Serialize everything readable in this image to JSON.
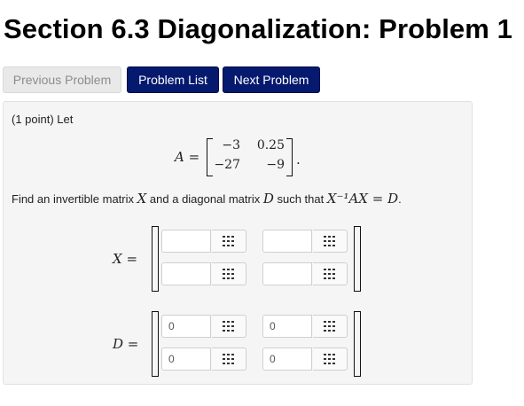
{
  "page": {
    "title": "Section 6.3 Diagonalization: Problem 1"
  },
  "nav": {
    "previous_label": "Previous Problem",
    "list_label": "Problem List",
    "next_label": "Next Problem"
  },
  "problem": {
    "intro": "(1 point) Let",
    "matrix_a_label": "A =",
    "matrix_a": [
      [
        "−3",
        "0.25"
      ],
      [
        "−27",
        "−9"
      ]
    ],
    "matrix_a_period": ".",
    "find_text_1": "Find an invertible matrix ",
    "find_var_x": "X",
    "find_text_2": " and a diagonal matrix ",
    "find_var_d": "D",
    "find_text_3": " such that ",
    "find_equation": "X⁻¹AX = D",
    "find_text_4": "."
  },
  "answer_x": {
    "label": "X =",
    "cells": [
      {
        "value": "",
        "placeholder": ""
      },
      {
        "value": "",
        "placeholder": ""
      },
      {
        "value": "",
        "placeholder": ""
      },
      {
        "value": "",
        "placeholder": ""
      }
    ]
  },
  "answer_d": {
    "label": "D =",
    "cells": [
      {
        "value": "0"
      },
      {
        "value": "0"
      },
      {
        "value": "0"
      },
      {
        "value": "0"
      }
    ]
  },
  "colors": {
    "primary_button": "#05196e",
    "disabled_button": "#e9e9e9",
    "panel_background": "#f5f5f5"
  },
  "icons": {
    "input_helper": "keypad-icon"
  }
}
